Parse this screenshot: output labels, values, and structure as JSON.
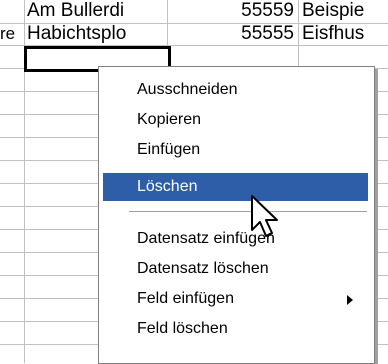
{
  "grid": {
    "row1": [
      "",
      "Am Bullerdi",
      "55559",
      "Beispie"
    ],
    "row2": [
      "re",
      "Habichtsplo",
      "55555",
      "Eisfhus"
    ]
  },
  "context_menu": {
    "items": [
      {
        "label": "Ausschneiden"
      },
      {
        "label": "Kopieren"
      },
      {
        "label": "Einfügen"
      },
      {
        "label": "Löschen",
        "selected": true
      },
      {
        "label": "Datensatz einfügen"
      },
      {
        "label": "Datensatz löschen"
      },
      {
        "label": "Feld einfügen",
        "submenu": true
      },
      {
        "label": "Feld löschen"
      }
    ],
    "selected_color": "#2e5ea8"
  },
  "cursor_icon": "arrow-pointer-icon"
}
